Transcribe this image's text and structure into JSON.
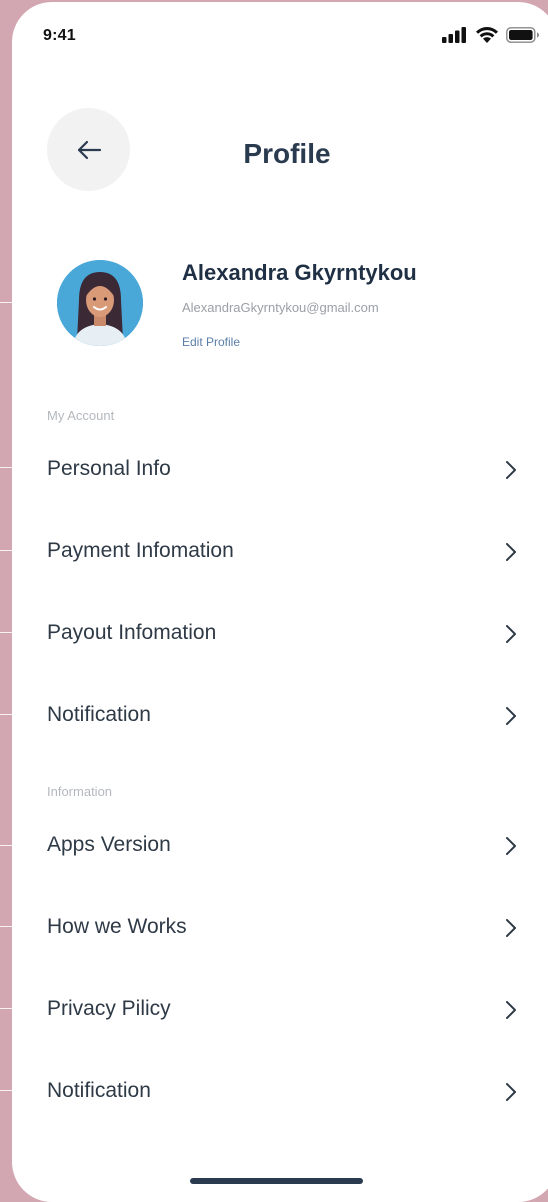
{
  "status_bar": {
    "time": "9:41"
  },
  "header": {
    "title": "Profile"
  },
  "profile": {
    "name": "Alexandra Gkyrntykou",
    "email": "AlexandraGkyrntykou@gmail.com",
    "edit_label": "Edit Profile"
  },
  "sections": {
    "account_label": "My Account",
    "account_items": [
      {
        "label": "Personal Info"
      },
      {
        "label": "Payment Infomation"
      },
      {
        "label": "Payout Infomation"
      },
      {
        "label": "Notification"
      }
    ],
    "information_label": "Information",
    "information_items": [
      {
        "label": "Apps Version"
      },
      {
        "label": "How we Works"
      },
      {
        "label": "Privacy Pilicy"
      },
      {
        "label": "Notification"
      }
    ]
  },
  "colors": {
    "background": "#d3a7b1",
    "title": "#2a3b4f",
    "text": "#2f3a47",
    "link": "#5a7ea8",
    "muted": "#b4b8bd"
  },
  "icons": {
    "back": "arrow-left-icon",
    "chevron": "chevron-right-icon",
    "signal": "cellular-signal-icon",
    "wifi": "wifi-icon",
    "battery": "battery-icon"
  }
}
